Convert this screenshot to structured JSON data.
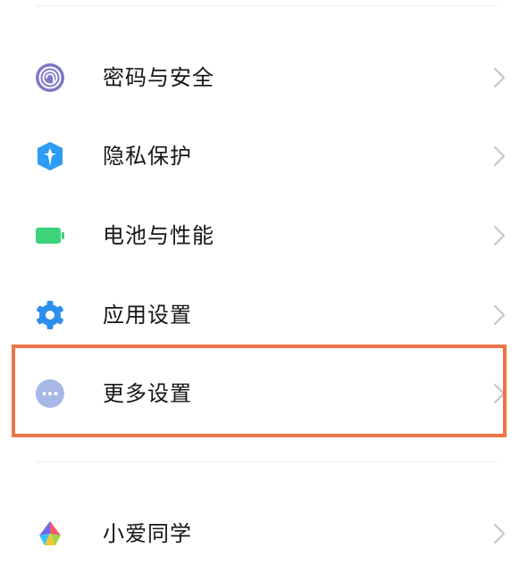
{
  "settings_list": {
    "items": [
      {
        "label": "密码与安全",
        "icon": "fingerprint-icon",
        "icon_color": "#7f77c9"
      },
      {
        "label": "隐私保护",
        "icon": "privacy-shield-icon",
        "icon_color": "#2e9cf2"
      },
      {
        "label": "电池与性能",
        "icon": "battery-icon",
        "icon_color": "#3ed27a"
      },
      {
        "label": "应用设置",
        "icon": "gear-icon",
        "icon_color": "#2d8fee"
      },
      {
        "label": "更多设置",
        "icon": "more-dots-icon",
        "icon_color": "#a8b8e6"
      },
      {
        "label": "小爱同学",
        "icon": "xiaoai-assistant-icon",
        "icon_color": "#6f6ae8"
      }
    ]
  },
  "highlight": {
    "target": "更多设置",
    "color": "#ee7346"
  },
  "colors": {
    "text": "#161616",
    "chevron": "#c4c4c4",
    "divider": "#ececec"
  }
}
